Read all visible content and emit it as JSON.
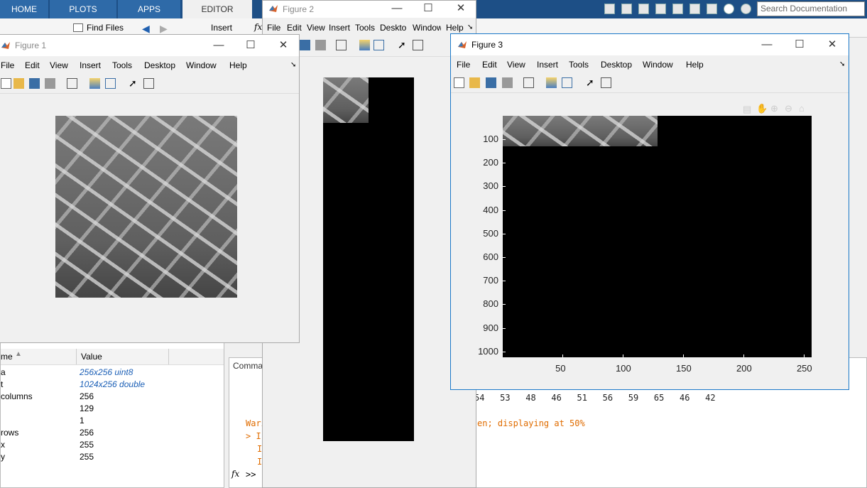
{
  "desktop": {
    "tabs": [
      "HOME",
      "PLOTS",
      "APPS",
      "EDITOR"
    ],
    "active_tab": "EDITOR",
    "search_placeholder": "Search Documentation",
    "toolstrip": {
      "find_files": "Find Files",
      "insert": "Insert",
      "fx": "fx"
    }
  },
  "workspace": {
    "header": {
      "name": "me",
      "value": "Value"
    },
    "rows": [
      {
        "name": "a",
        "value": "256x256 uint8",
        "link": true
      },
      {
        "name": "t",
        "value": "1024x256 double",
        "link": true
      },
      {
        "name": "columns",
        "value": "256",
        "link": false
      },
      {
        "name": "",
        "value": "129",
        "link": false
      },
      {
        "name": "",
        "value": "1",
        "link": false
      },
      {
        "name": "rows",
        "value": "256",
        "link": false
      },
      {
        "name": "x",
        "value": "255",
        "link": false
      },
      {
        "name": "y",
        "value": "255",
        "link": false
      }
    ]
  },
  "command_window": {
    "title": "Comma",
    "numbers_line": "54   53   48   46   51   56   59   65   46   42",
    "warning_start": "Wari",
    "warning_end": "en; displaying at 50%",
    "line_gt": "> I",
    "line_i1": "I",
    "line_i2": "I",
    "prompt": ">>"
  },
  "figure1": {
    "title": "Figure 1",
    "menu": [
      "File",
      "Edit",
      "View",
      "Insert",
      "Tools",
      "Desktop",
      "Window",
      "Help"
    ]
  },
  "figure2": {
    "title": "Figure 2",
    "menu": [
      "File",
      "Edit",
      "View",
      "Insert",
      "Tools",
      "Desktop",
      "Window",
      "Help"
    ]
  },
  "figure3": {
    "title": "Figure 3",
    "menu": [
      "File",
      "Edit",
      "View",
      "Insert",
      "Tools",
      "Desktop",
      "Window",
      "Help"
    ],
    "chart_data": {
      "type": "heatmap",
      "description_axis": "image display",
      "x_ticks": [
        50,
        100,
        150,
        200,
        250
      ],
      "y_ticks": [
        100,
        200,
        300,
        400,
        500,
        600,
        700,
        800,
        900,
        1000
      ],
      "xlim": [
        0.5,
        256.5
      ],
      "ylim": [
        0.5,
        1024.5
      ],
      "image_extent": {
        "x": [
          1,
          128
        ],
        "y": [
          1,
          128
        ]
      }
    }
  }
}
